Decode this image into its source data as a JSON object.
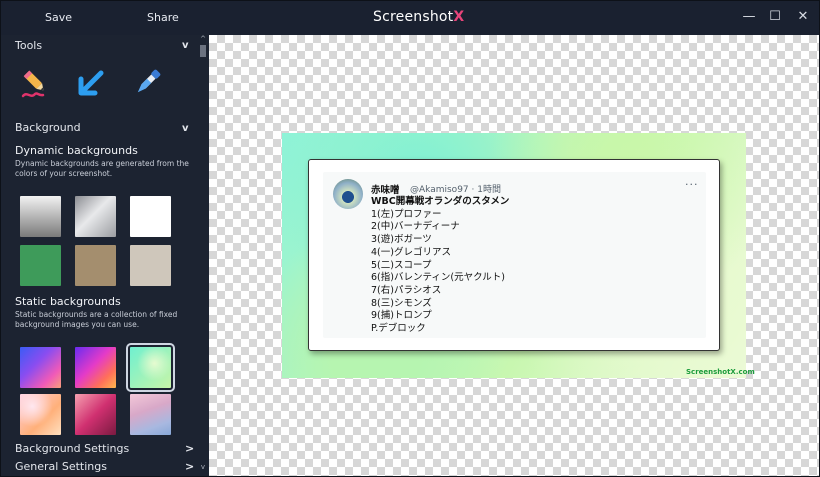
{
  "titlebar": {
    "save": "Save",
    "share": "Share",
    "title_main": "Screenshot",
    "title_accent": "X",
    "minimize": "—",
    "maximize": "☐",
    "close": "✕"
  },
  "sidebar": {
    "tools_label": "Tools",
    "tools_chevron": "v",
    "tools": [
      "highlighter-pen-icon",
      "arrow-icon",
      "color-picker-icon"
    ],
    "background_label": "Background",
    "background_chevron": "v",
    "dynamic_title": "Dynamic backgrounds",
    "dynamic_desc": "Dynamic backgrounds are generated from the colors of your screenshot.",
    "static_title": "Static backgrounds",
    "static_desc": "Static backgrounds are a collection of fixed background images you can use.",
    "background_settings": "Background Settings",
    "general_settings": "General Settings",
    "settings_chevron": ">",
    "scroll_up": "^",
    "scroll_down": "v"
  },
  "swatch_colors": {
    "dynamic": [
      "#b8b8b8",
      "#a9aaae",
      "#ffffff",
      "#3e9b5a",
      "#a48e6e",
      "#cfc7bb"
    ],
    "accent": "#e8447a"
  },
  "tweet": {
    "name": "赤味噌",
    "handle": "@Akamiso97 · 1時間",
    "more": "···",
    "lines": [
      "WBC開幕戦オランダのスタメン",
      "1(左)プロファー",
      "2(中)バーナディーナ",
      "3(遊)ボガーツ",
      "4(一)グレゴリアス",
      "5(二)スコープ",
      "6(指)バレンティン(元ヤクルト)",
      "7(右)パラシオス",
      "8(三)シモンズ",
      "9(捕)トロンプ",
      "P.デブロック"
    ]
  },
  "watermark": "ScreenshotX.com"
}
